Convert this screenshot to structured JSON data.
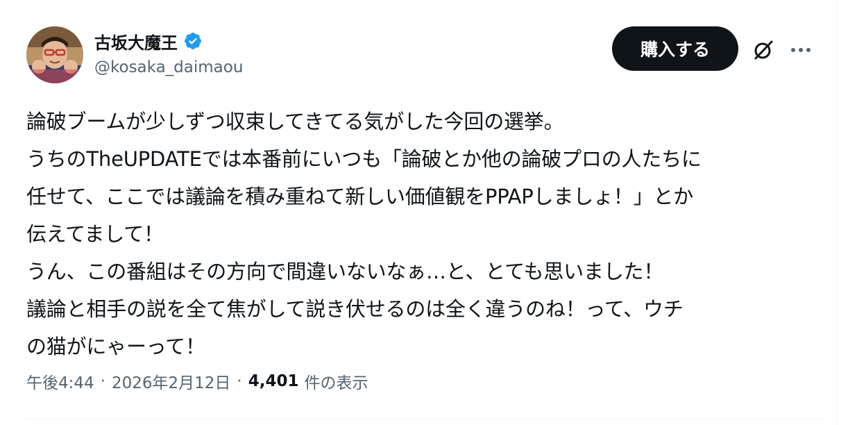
{
  "author": {
    "display_name": "古坂大魔王",
    "handle": "@kosaka_daimaou",
    "verified_icon": "verified-badge-icon",
    "avatar_icon": "avatar"
  },
  "header": {
    "buy_button_label": "購入する",
    "grok_icon": "grok-icon",
    "more_icon": "more-icon"
  },
  "tweet": {
    "lines": [
      "論破ブームが少しずつ収束してきてる気がした今回の選挙。",
      "うちのTheUPDATEでは本番前にいつも「論破とか他の論破プロの人たちに",
      "任せて、ここでは議論を積み重ねて新しい価値観をPPAPしましょ！」とか",
      "伝えてまして！",
      "うん、この番組はその方向で間違いないなぁ…と、とても思いました！",
      "議論と相手の説を全て焦がして説き伏せるのは全く違うのね！って、ウチ",
      "の猫がにゃーって！"
    ]
  },
  "meta": {
    "time": "午後4:44",
    "separator": "·",
    "date": "2026年2月12日",
    "views_count": "4,401",
    "views_label": "件の表示"
  },
  "colors": {
    "text_primary": "#0f1419",
    "text_secondary": "#536471",
    "verified_blue": "#1d9bf0",
    "button_dark": "#0f1419",
    "divider": "#eff3f4"
  }
}
